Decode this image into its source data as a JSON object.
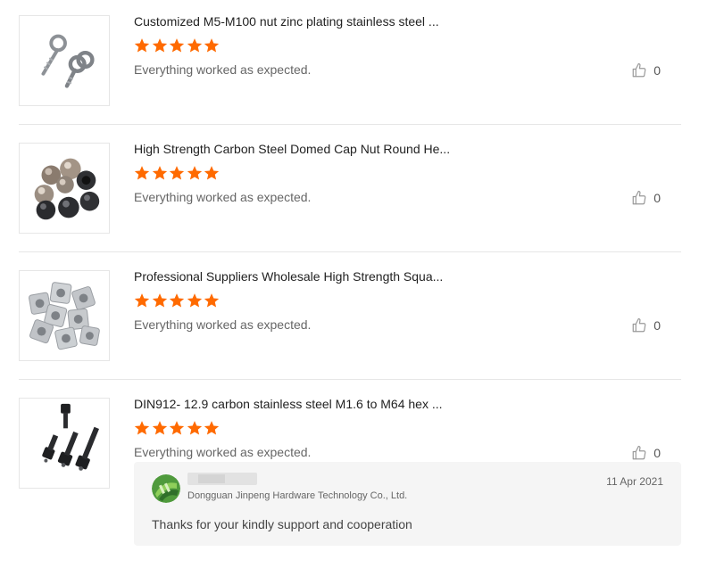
{
  "reviews": [
    {
      "product_title": "Customized M5-M100 nut zinc plating stainless steel ...",
      "rating": 5,
      "comment": "Everything worked as expected.",
      "likes": "0",
      "image_icon": "eye-bolt-image"
    },
    {
      "product_title": "High Strength Carbon Steel Domed Cap Nut Round He...",
      "rating": 5,
      "comment": "Everything worked as expected.",
      "likes": "0",
      "image_icon": "cap-nut-image"
    },
    {
      "product_title": "Professional Suppliers Wholesale High Strength Squa...",
      "rating": 5,
      "comment": "Everything worked as expected.",
      "likes": "0",
      "image_icon": "square-nut-image"
    },
    {
      "product_title": "DIN912- 12.9 carbon stainless steel M1.6 to M64 hex ...",
      "rating": 5,
      "comment": "Everything worked as expected.",
      "likes": "0",
      "image_icon": "hex-socket-bolt-image",
      "reply": {
        "company": "Dongguan Jinpeng Hardware Technology Co., Ltd.",
        "date": "11 Apr 2021",
        "message": "Thanks for your kindly support and cooperation"
      }
    }
  ],
  "colors": {
    "star": "#ff6a00",
    "divider": "#e6e6e6",
    "reply_bg": "#f5f5f5"
  }
}
